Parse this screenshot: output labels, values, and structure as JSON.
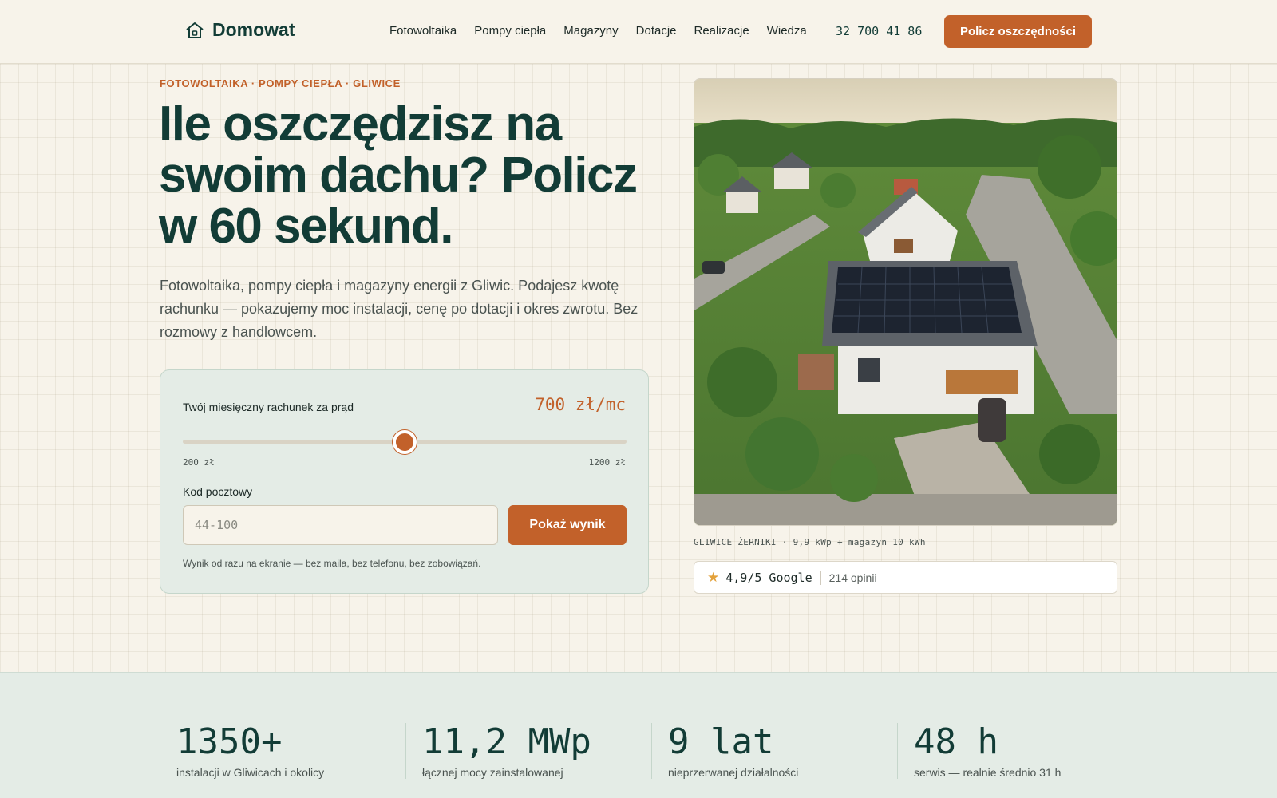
{
  "brand": {
    "name": "Domowat",
    "icon": "house-icon"
  },
  "nav": {
    "items": [
      "Fotowoltaika",
      "Pompy ciepła",
      "Magazyny",
      "Dotacje",
      "Realizacje",
      "Wiedza"
    ],
    "phone": "32 700 41 86",
    "cta": "Policz oszczędności"
  },
  "hero": {
    "eyebrow": "FOTOWOLTAIKA · POMPY CIEPŁA · GLIWICE",
    "headline": "Ile oszczędzisz na swoim dachu? Policz w 60 sekund.",
    "lead": "Fotowoltaika, pompy ciepła i magazyny energii z Gliwic. Podajesz kwotę rachunku — pokazujemy moc instalacji, cenę po dotacji i okres zwrotu. Bez rozmowy z handlowcem."
  },
  "calculator": {
    "bill_label": "Twój miesięczny rachunek za prąd",
    "bill_value": "700 zł/mc",
    "slider": {
      "min_label": "200 zł",
      "max_label": "1200 zł",
      "min": 200,
      "max": 1200,
      "value": 700
    },
    "zip_label": "Kod pocztowy",
    "zip_placeholder": "44-100",
    "submit": "Pokaż wynik",
    "note": "Wynik od razu na ekranie — bez maila, bez telefonu, bez zobowiązań."
  },
  "photo": {
    "caption": "GLIWICE ŻERNIKI · 9,9 kWp + magazyn 10 kWh"
  },
  "rating": {
    "icon": "star-icon",
    "score": "4,9/5 Google",
    "count": "214 opinii"
  },
  "stats": [
    {
      "value": "1350+",
      "label": "instalacji w Gliwicach i okolicy"
    },
    {
      "value": "11,2 MWp",
      "label": "łącznej mocy zainstalowanej"
    },
    {
      "value": "9 lat",
      "label": "nieprzerwanej działalności"
    },
    {
      "value": "48 h",
      "label": "serwis — realnie średnio 31 h"
    }
  ],
  "colors": {
    "brand_dark": "#123c36",
    "accent": "#c2612a",
    "mint": "#e4ece6",
    "cream": "#f7f3ea"
  }
}
